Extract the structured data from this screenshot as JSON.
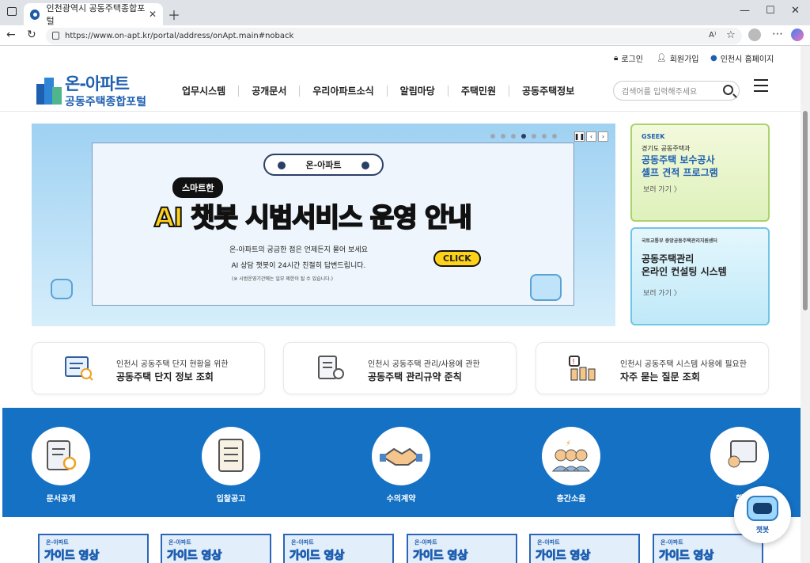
{
  "browser": {
    "tab_title": "인천광역시 공동주택종합포털",
    "url": "https://www.on-apt.kr/portal/address/onApt.main#noback",
    "icons": [
      "tab-switch-icon",
      "close-icon",
      "new-tab-icon",
      "back-icon",
      "refresh-icon",
      "lock-icon",
      "read-aloud-icon",
      "favorite-icon",
      "profile-icon",
      "more-icon",
      "copilot-icon"
    ]
  },
  "utility": {
    "login": "로그인",
    "join": "회원가입",
    "city_home": "인천시 홈페이지"
  },
  "logo": {
    "title": "온-아파트",
    "subtitle": "공동주택종합포털"
  },
  "gnb": [
    "업무시스템",
    "공개문서",
    "우리아파트소식",
    "알림마당",
    "주택민원",
    "공동주택정보"
  ],
  "search": {
    "placeholder": "검색어를 입력해주세요"
  },
  "hero": {
    "pill": "온-아파트",
    "badge": "스마트한",
    "headline_a": "AI 챗봇",
    "headline_b": "시범서비스",
    "headline_c": "운영 안내",
    "sub1": "온-아파트의 궁금한 점은 언제든지 물어 보세요",
    "sub2": "AI 상담 챗봇이 24시간 친절히 답변드립니다.",
    "note": "(※ 시범운영기간에는 일부 제한이 될 수 있습니다.)",
    "click": "CLICK",
    "slides": 7,
    "active_slide": 4
  },
  "side_banners": [
    {
      "org": "GSEEK",
      "caption": "경기도 공동주택과",
      "title1": "공동주택 보수공사",
      "title2": "셀프 견적 프로그램",
      "more": "보러 가기 〉"
    },
    {
      "org": "국토교통부 중앙공동주택관리지원센터",
      "caption": "",
      "title1": "공동주택관리",
      "title2": "온라인 컨설팅 시스템",
      "more": "보러 가기 〉"
    }
  ],
  "quick_cards": [
    {
      "line1": "인천시 공동주택 단지 현황을 위한",
      "line2": "공동주택 단지 정보 조회"
    },
    {
      "line1": "인천시 공동주택 관리/사용에 관한",
      "line2": "공동주택 관리규약 준칙"
    },
    {
      "line1": "인천시 공동주택 시스템 사용에 필요한",
      "line2": "자주 묻는 질문 조회"
    }
  ],
  "services": [
    "문서공개",
    "입찰공고",
    "수의계약",
    "층간소음",
    "행"
  ],
  "videos": [
    {
      "tag": "온-아파트",
      "title": "가이드 영상"
    },
    {
      "tag": "온-아파트",
      "title": "가이드 영상"
    },
    {
      "tag": "온-아파트",
      "title": "가이드 영상"
    },
    {
      "tag": "온-아파트",
      "title": "가이드 영상"
    },
    {
      "tag": "온-아파트",
      "title": "가이드 영상"
    },
    {
      "tag": "온-아파트",
      "title": "가이드 영상"
    }
  ],
  "chatbot": {
    "label": "챗봇"
  },
  "colors": {
    "brand": "#1e5fb0",
    "band": "#1471c4",
    "accent_yellow": "#ffd21a"
  }
}
